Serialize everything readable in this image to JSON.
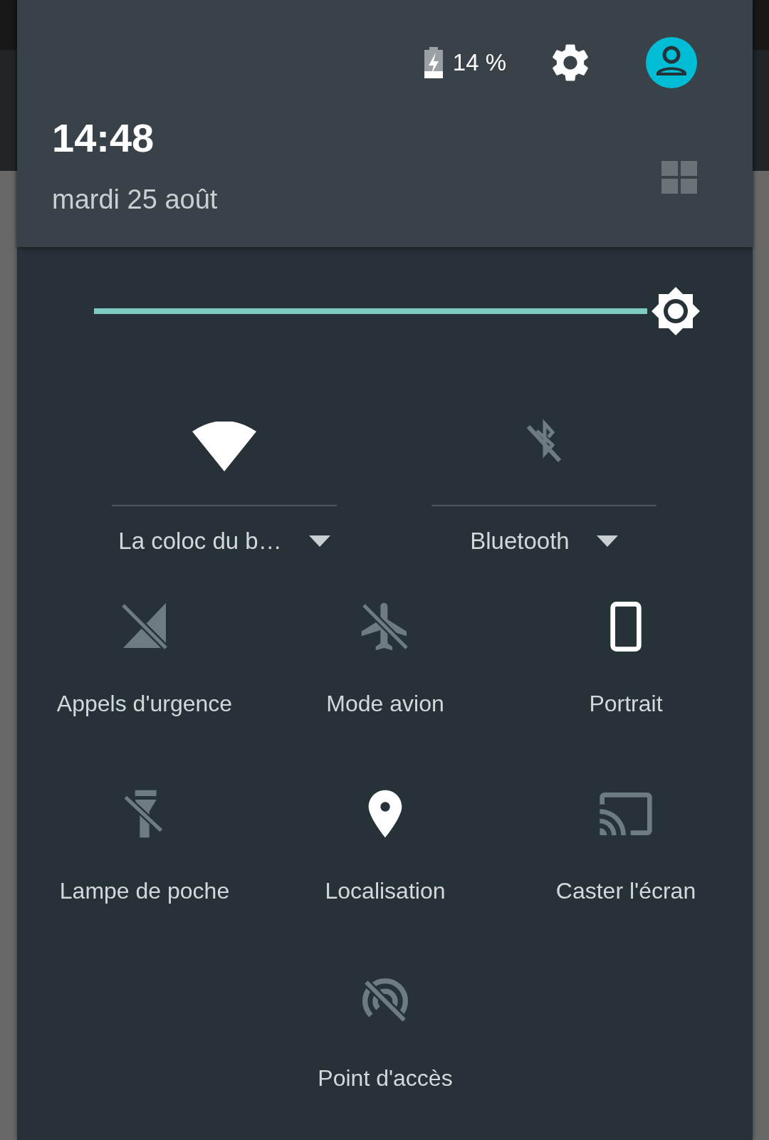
{
  "header": {
    "battery": "14 %",
    "time": "14:48",
    "date": "mardi 25 août"
  },
  "brightness": {
    "level": 1.0
  },
  "wide_tiles": [
    {
      "label": "La coloc du b…",
      "on": true
    },
    {
      "label": "Bluetooth",
      "on": false
    }
  ],
  "tiles": [
    {
      "label": "Appels d'urgence",
      "on": false
    },
    {
      "label": "Mode avion",
      "on": false
    },
    {
      "label": "Portrait",
      "on": true
    },
    {
      "label": "Lampe de poche",
      "on": false
    },
    {
      "label": "Localisation",
      "on": true
    },
    {
      "label": "Caster l'écran",
      "on": false
    },
    {
      "label": "Point d'accès",
      "on": false
    }
  ]
}
